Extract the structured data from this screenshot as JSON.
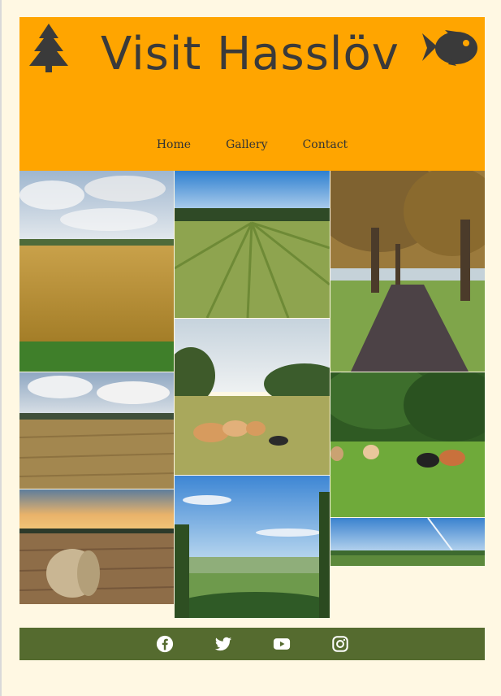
{
  "brand": {
    "title": "Visit Hasslöv",
    "left_icon": "tree-icon",
    "right_icon": "fish-icon"
  },
  "nav": {
    "items": [
      {
        "label": "Home"
      },
      {
        "label": "Gallery"
      },
      {
        "label": "Contact"
      }
    ]
  },
  "gallery": {
    "photos": [
      {
        "name": "wheat-field-photo"
      },
      {
        "name": "cut-hay-rows-photo"
      },
      {
        "name": "tree-lined-road-photo"
      },
      {
        "name": "harvested-field-photo"
      },
      {
        "name": "cattle-pasture-photo"
      },
      {
        "name": "calves-in-meadow-photo"
      },
      {
        "name": "hay-bale-sunset-photo"
      },
      {
        "name": "valley-view-photo"
      },
      {
        "name": "hills-panorama-photo"
      }
    ]
  },
  "footer": {
    "social_icons": [
      "facebook-icon",
      "twitter-icon",
      "youtube-icon",
      "instagram-icon"
    ]
  },
  "colors": {
    "page_background": "#fff8e3",
    "header_background": "#ffa500",
    "footer_background": "#556b2f",
    "title_text": "#3a3a3a",
    "nav_text": "#333333"
  }
}
